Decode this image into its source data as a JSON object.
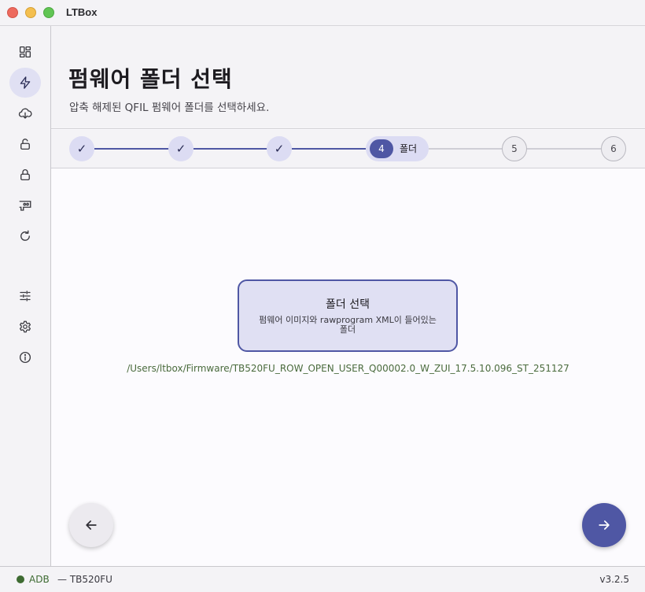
{
  "window": {
    "title": "LTBox"
  },
  "sidebar": {
    "items": [
      {
        "icon": "dashboard-icon",
        "active": false
      },
      {
        "icon": "flash-icon",
        "active": true
      },
      {
        "icon": "cloud-download-icon",
        "active": false
      },
      {
        "icon": "unlock-icon",
        "active": false
      },
      {
        "icon": "lock-icon",
        "active": false
      },
      {
        "icon": "chip-icon",
        "active": false
      },
      {
        "icon": "refresh-icon",
        "active": false
      },
      {
        "icon": "tune-icon",
        "active": false
      },
      {
        "icon": "settings-icon",
        "active": false
      },
      {
        "icon": "info-icon",
        "active": false
      }
    ]
  },
  "header": {
    "title": "펌웨어 폴더 선택",
    "subtitle": "압축 해제된 QFIL 펌웨어 폴더를 선택하세요."
  },
  "stepper": {
    "steps": [
      {
        "label": "✓",
        "state": "done"
      },
      {
        "label": "✓",
        "state": "done"
      },
      {
        "label": "✓",
        "state": "done"
      },
      {
        "label": "4",
        "state": "current",
        "title": "폴더"
      },
      {
        "label": "5",
        "state": "todo"
      },
      {
        "label": "6",
        "state": "todo"
      }
    ]
  },
  "folder_card": {
    "title": "폴더 선택",
    "description": "펌웨어 이미지와 rawprogram XML이 들어있는 폴더"
  },
  "folder_path": "/Users/ltbox/Firmware/TB520FU_ROW_OPEN_USER_Q00002.0_W_ZUI_17.5.10.096_ST_251127",
  "status": {
    "connection": "ADB",
    "device": "— TB520FU",
    "version": "v3.2.5",
    "connection_color": "#3e6b32"
  },
  "colors": {
    "accent": "#4f57a4",
    "accent_light": "#e0e0f3"
  }
}
